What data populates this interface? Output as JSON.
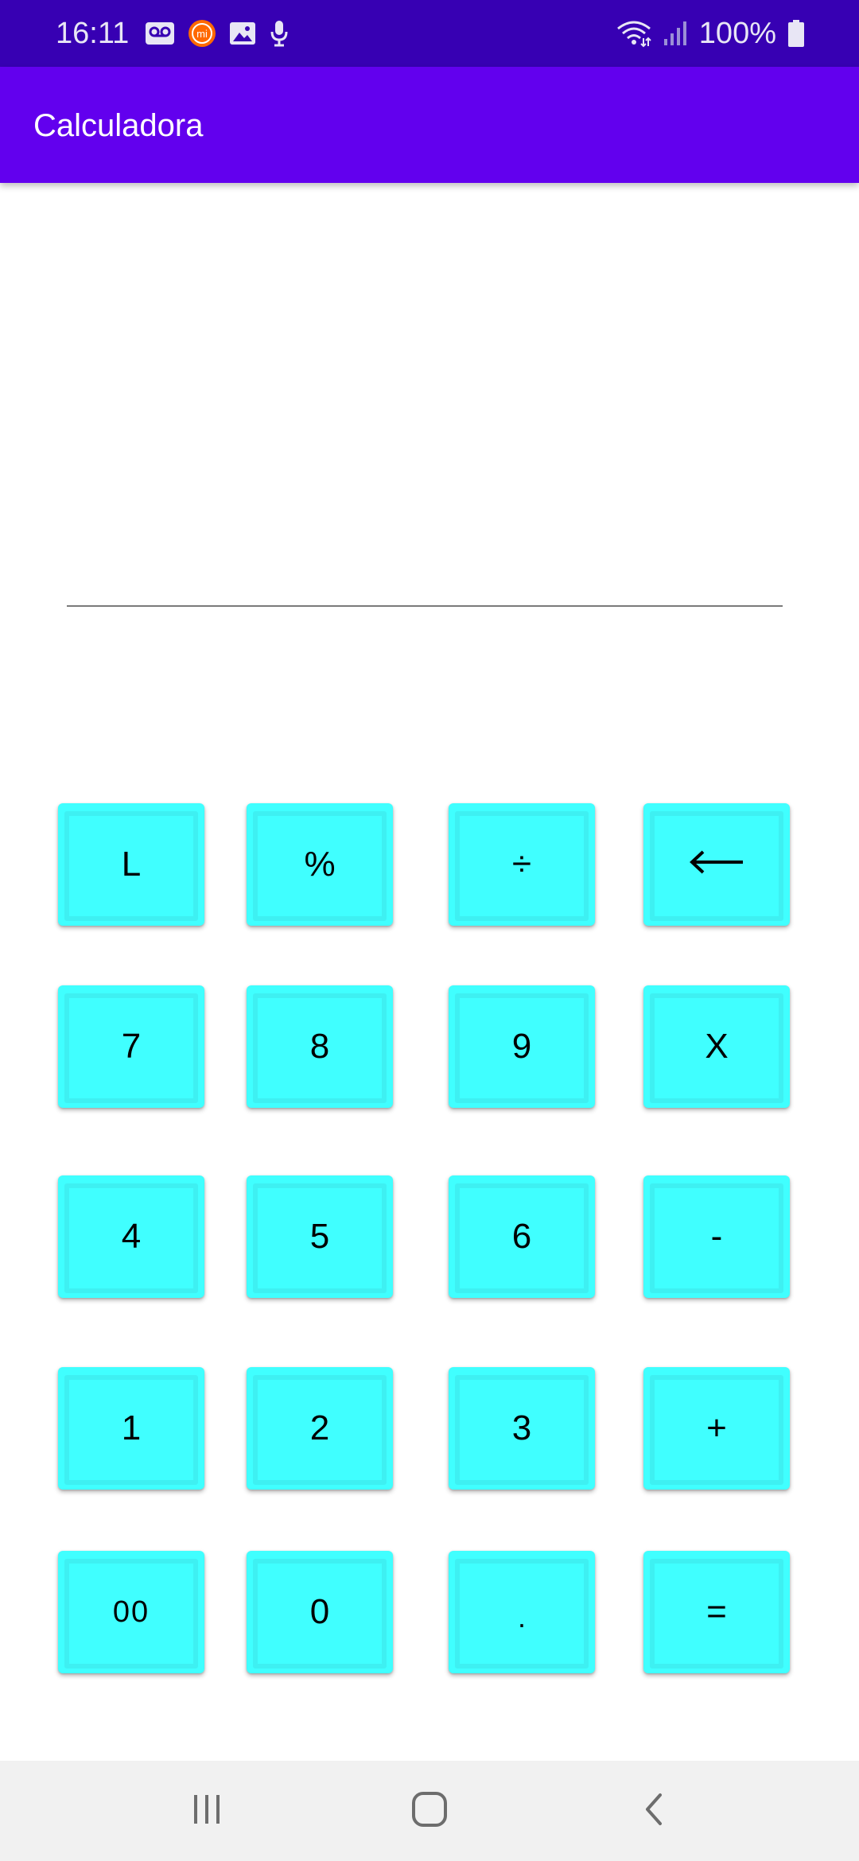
{
  "status_bar": {
    "time": "16:11",
    "battery": "100%",
    "icons_left": [
      "voicemail-icon",
      "mi-icon",
      "gallery-icon",
      "mic-icon"
    ],
    "icons_right": [
      "wifi-icon",
      "signal-icon",
      "battery-icon"
    ]
  },
  "app_bar": {
    "title": "Calculadora"
  },
  "display": {
    "value": ""
  },
  "keypad": {
    "rows": [
      [
        "L",
        "%",
        "÷",
        "←"
      ],
      [
        "7",
        "8",
        "9",
        "X"
      ],
      [
        "4",
        "5",
        "6",
        "-"
      ],
      [
        "1",
        "2",
        "3",
        "+"
      ],
      [
        "00",
        "0",
        ".",
        "="
      ]
    ]
  },
  "nav_bar": {
    "buttons": [
      "recent-apps-icon",
      "home-icon",
      "back-icon"
    ]
  },
  "colors": {
    "status_bar": "#3700b3",
    "app_bar": "#6200ee",
    "key": "#40ffff",
    "nav_bar": "#f1f1f1"
  }
}
